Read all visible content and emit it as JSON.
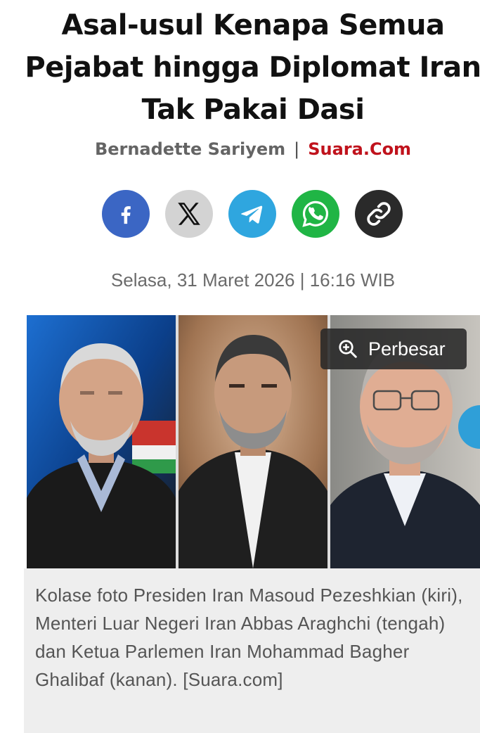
{
  "article": {
    "headline": "Asal-usul Kenapa Semua Pejabat hingga Diplomat Iran Tak Pakai Dasi",
    "author": "Bernadette Sariyem",
    "separator": "|",
    "source": "Suara.Com",
    "date": "Selasa, 31 Maret 2026 | 16:16 WIB"
  },
  "share": {
    "items": [
      {
        "name": "facebook",
        "icon": "facebook-icon",
        "color": "#3b66c4"
      },
      {
        "name": "x",
        "icon": "x-icon",
        "color": "#d3d3d3"
      },
      {
        "name": "telegram",
        "icon": "telegram-icon",
        "color": "#2fa6df"
      },
      {
        "name": "whatsapp",
        "icon": "whatsapp-icon",
        "color": "#20b545"
      },
      {
        "name": "copy-link",
        "icon": "link-icon",
        "color": "#2a2a2a"
      }
    ]
  },
  "image": {
    "zoom_label": "Perbesar",
    "zoom_icon": "zoom-in-icon",
    "caption": "Kolase foto Presiden Iran Masoud Pezeshkian (kiri), Menteri Luar Negeri Iran Abbas Araghchi (tengah) dan Ketua Parlemen Iran Mohammad Bagher Ghalibaf (kanan). [Suara.com]"
  },
  "colors": {
    "source_red": "#c0121c",
    "caption_bg": "#eeeeee"
  }
}
